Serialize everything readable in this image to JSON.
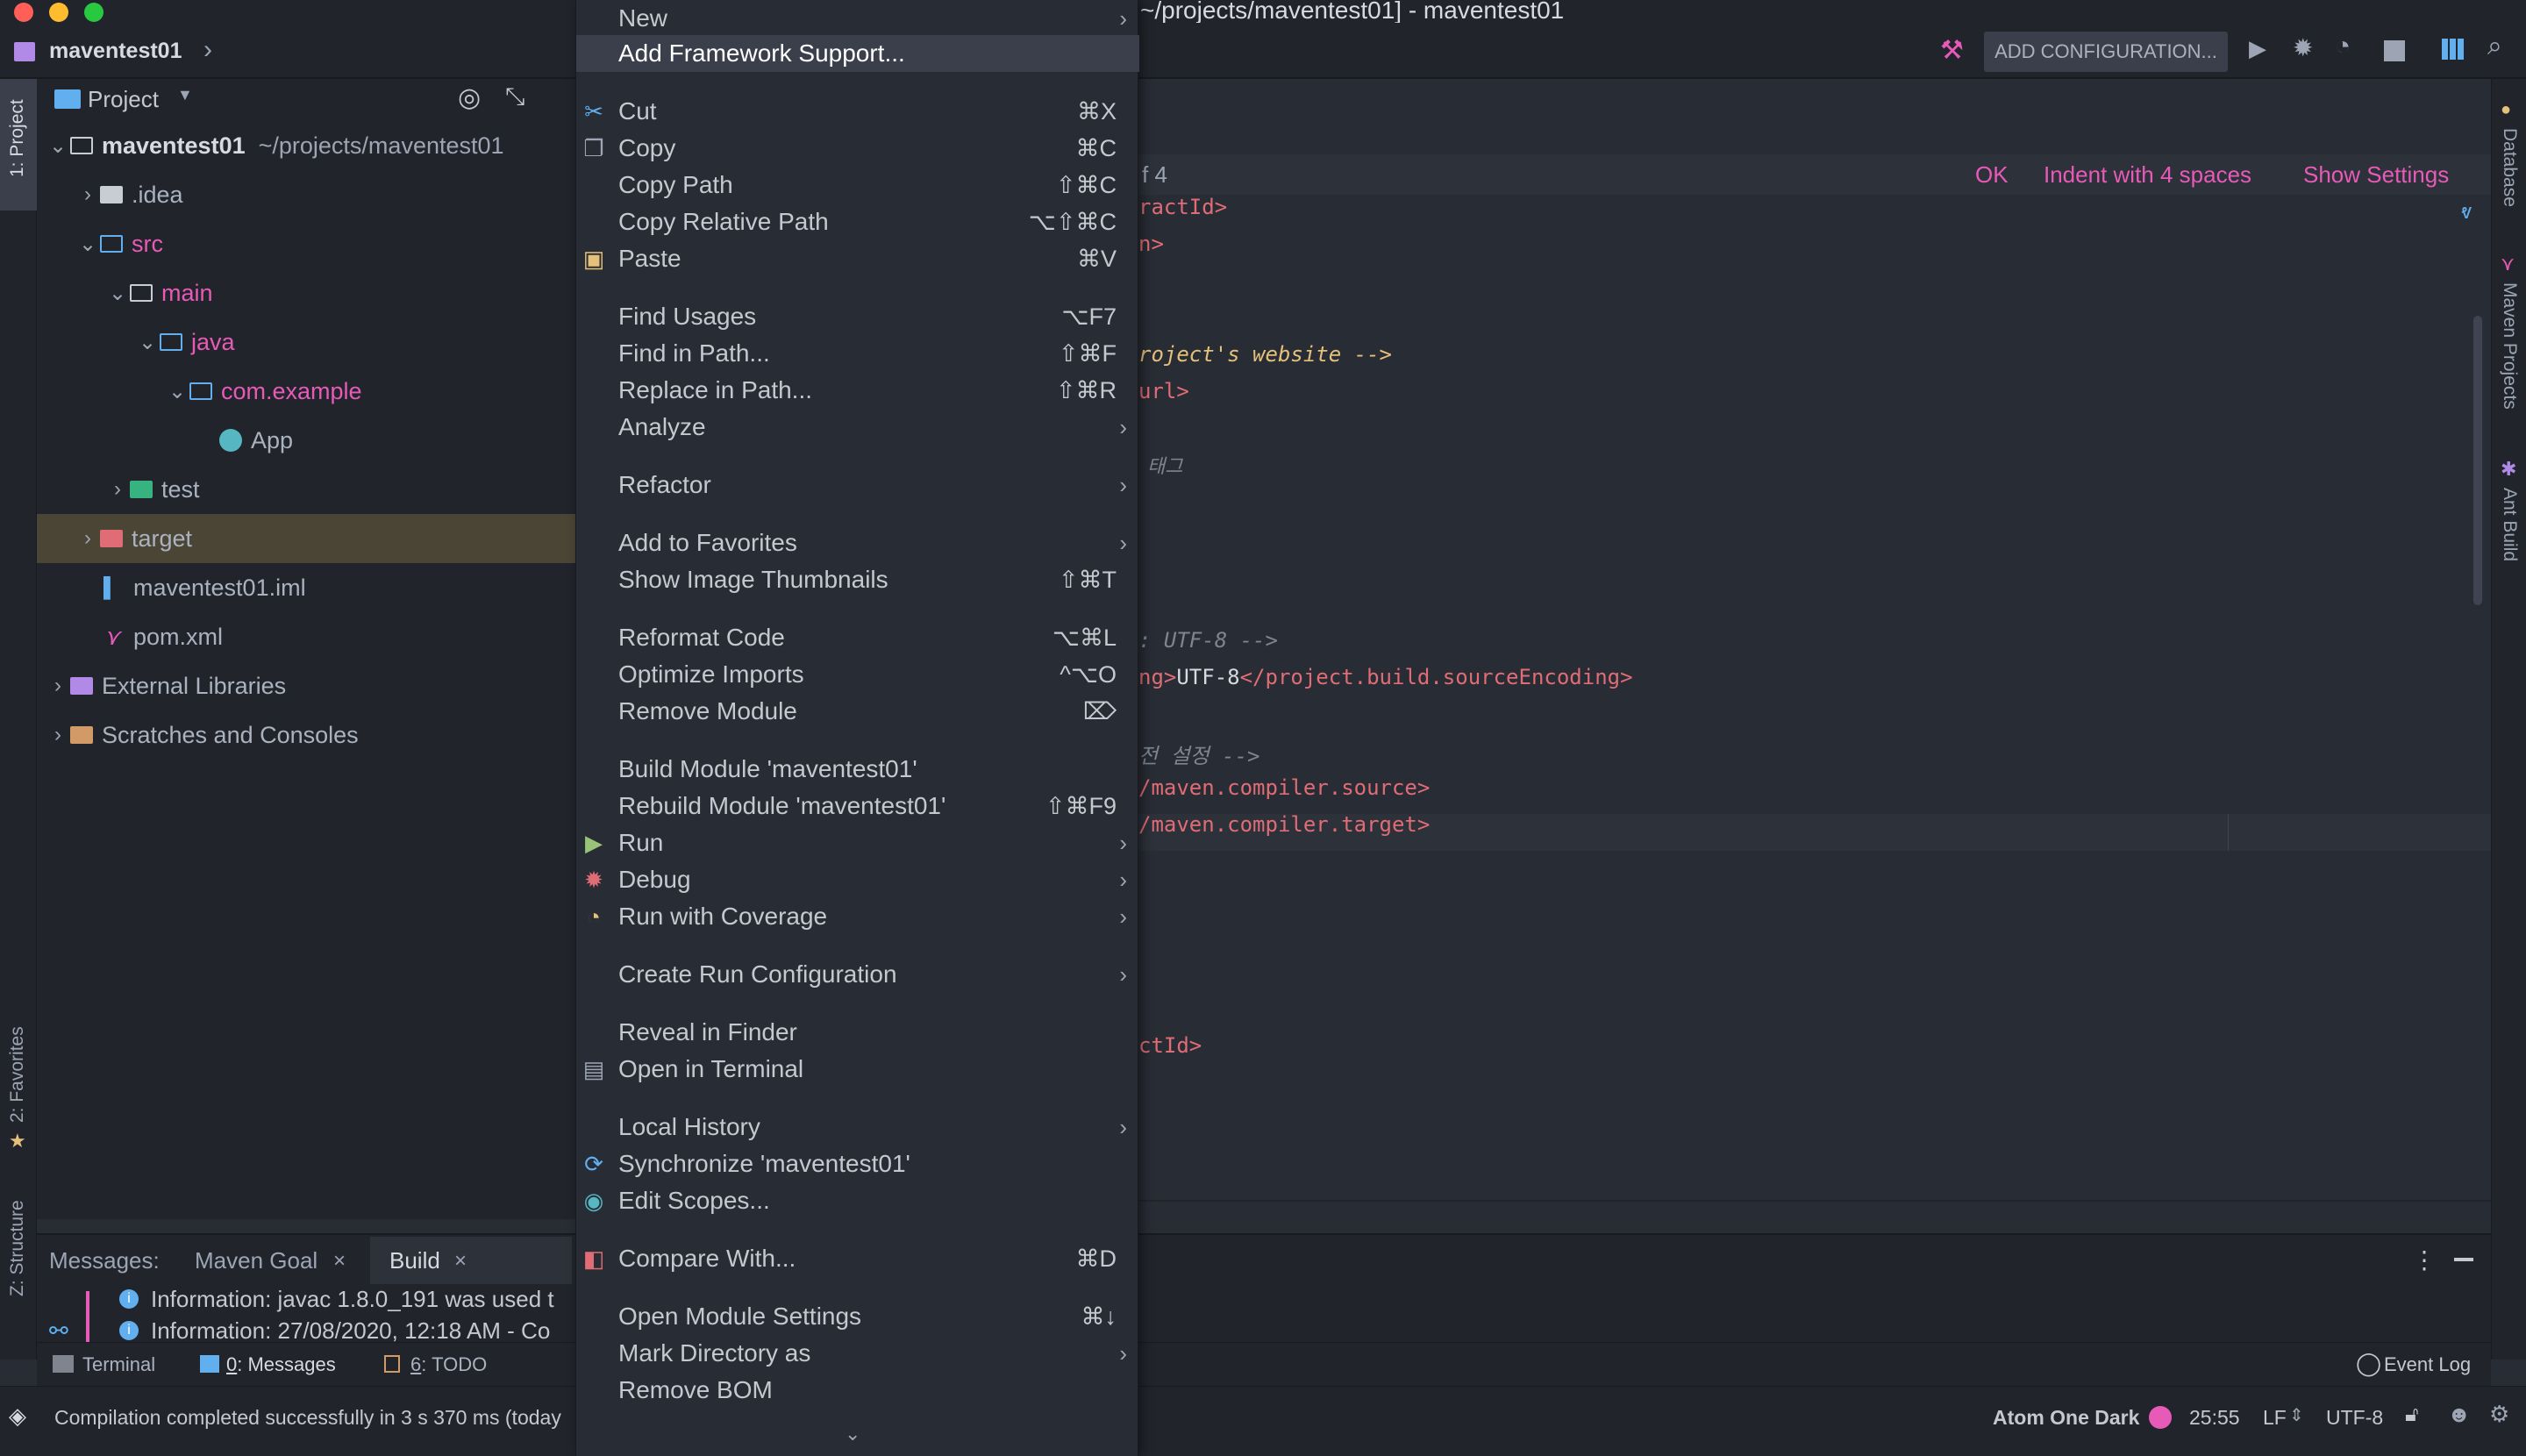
{
  "window": {
    "title": "~/projects/maventest01] - maventest01"
  },
  "navbar": {
    "breadcrumb": "maventest01",
    "run_config": "ADD CONFIGURATION..."
  },
  "left_stripe": {
    "project_tab": "1: Project",
    "favorites_tab": "2: Favorites",
    "structure_tab": "Z: Structure"
  },
  "right_stripe": {
    "database_tab": "Database",
    "maven_tab": "Maven Projects",
    "ant_tab": "Ant Build"
  },
  "project_panel": {
    "view_selector": "Project",
    "tree": [
      {
        "label": "maventest01",
        "detail": "~/projects/maventest01"
      },
      {
        "label": ".idea"
      },
      {
        "label": "src"
      },
      {
        "label": "main"
      },
      {
        "label": "java"
      },
      {
        "label": "com.example"
      },
      {
        "label": "App"
      },
      {
        "label": "test"
      },
      {
        "label": "target"
      },
      {
        "label": "maventest01.iml"
      },
      {
        "label": "pom.xml"
      },
      {
        "label": "External Libraries"
      },
      {
        "label": "Scratches and Consoles"
      }
    ]
  },
  "context_menu": {
    "items": [
      {
        "label": "New",
        "submenu": true
      },
      {
        "label": "Add Framework Support..."
      },
      {
        "label": "Cut",
        "shortcut": "⌘X",
        "icon": "scissors-icon"
      },
      {
        "label": "Copy",
        "shortcut": "⌘C",
        "icon": "copy-icon"
      },
      {
        "label": "Copy Path",
        "shortcut": "⇧⌘C"
      },
      {
        "label": "Copy Relative Path",
        "shortcut": "⌥⇧⌘C"
      },
      {
        "label": "Paste",
        "shortcut": "⌘V",
        "icon": "clipboard-icon"
      },
      {
        "label": "Find Usages",
        "shortcut": "⌥F7"
      },
      {
        "label": "Find in Path...",
        "shortcut": "⇧⌘F"
      },
      {
        "label": "Replace in Path...",
        "shortcut": "⇧⌘R"
      },
      {
        "label": "Analyze",
        "submenu": true
      },
      {
        "label": "Refactor",
        "submenu": true
      },
      {
        "label": "Add to Favorites",
        "submenu": true
      },
      {
        "label": "Show Image Thumbnails",
        "shortcut": "⇧⌘T"
      },
      {
        "label": "Reformat Code",
        "shortcut": "⌥⌘L"
      },
      {
        "label": "Optimize Imports",
        "shortcut": "^⌥O"
      },
      {
        "label": "Remove Module",
        "shortcut": "⌦"
      },
      {
        "label": "Build Module 'maventest01'"
      },
      {
        "label": "Rebuild Module 'maventest01'",
        "shortcut": "⇧⌘F9"
      },
      {
        "label": "Run",
        "submenu": true,
        "icon": "run-icon"
      },
      {
        "label": "Debug",
        "submenu": true,
        "icon": "debug-icon"
      },
      {
        "label": "Run with Coverage",
        "submenu": true,
        "icon": "coverage-icon"
      },
      {
        "label": "Create Run Configuration",
        "submenu": true
      },
      {
        "label": "Reveal in Finder"
      },
      {
        "label": "Open in Terminal",
        "icon": "terminal-icon"
      },
      {
        "label": "Local History",
        "submenu": true
      },
      {
        "label": "Synchronize 'maventest01'",
        "icon": "sync-icon"
      },
      {
        "label": "Edit Scopes...",
        "icon": "scope-icon"
      },
      {
        "label": "Compare With...",
        "shortcut": "⌘D",
        "icon": "compare-icon"
      },
      {
        "label": "Open Module Settings",
        "shortcut": "⌘↓"
      },
      {
        "label": "Mark Directory as",
        "submenu": true
      },
      {
        "label": "Remove BOM"
      }
    ]
  },
  "editor": {
    "notification": {
      "prefix": "f 4",
      "ok": "OK",
      "indent": "Indent with 4 spaces",
      "settings": "Show Settings"
    },
    "lines": [
      {
        "text": "ractId>"
      },
      {
        "text": "n>"
      },
      {
        "text": "roject's website -->"
      },
      {
        "text": "url>"
      },
      {
        "text": "태그"
      },
      {
        "text": ": UTF-8 -->"
      },
      {
        "pre": "ng>",
        "mid": "UTF-8",
        "post": "</project.build.sourceEncoding>"
      },
      {
        "text": "전 설정 -->"
      },
      {
        "text": "/maven.compiler.source>"
      },
      {
        "text": "/maven.compiler.target>"
      },
      {
        "text": "ctId>"
      }
    ]
  },
  "messages": {
    "label": "Messages:",
    "tabs": [
      "Maven Goal",
      "Build"
    ],
    "lines": [
      "Information: javac 1.8.0_191 was used t",
      "Information: 27/08/2020, 12:18 AM - Co"
    ]
  },
  "tool_tabs": {
    "terminal": "Terminal",
    "messages_num": "0",
    "messages": ": Messages",
    "todo_num": "6",
    "todo": ": TODO",
    "event_log": "Event Log"
  },
  "status": {
    "message": "Compilation completed successfully in 3 s 370 ms (today",
    "theme": "Atom One Dark",
    "position": "25:55",
    "line_sep": "LF",
    "encoding": "UTF-8"
  }
}
